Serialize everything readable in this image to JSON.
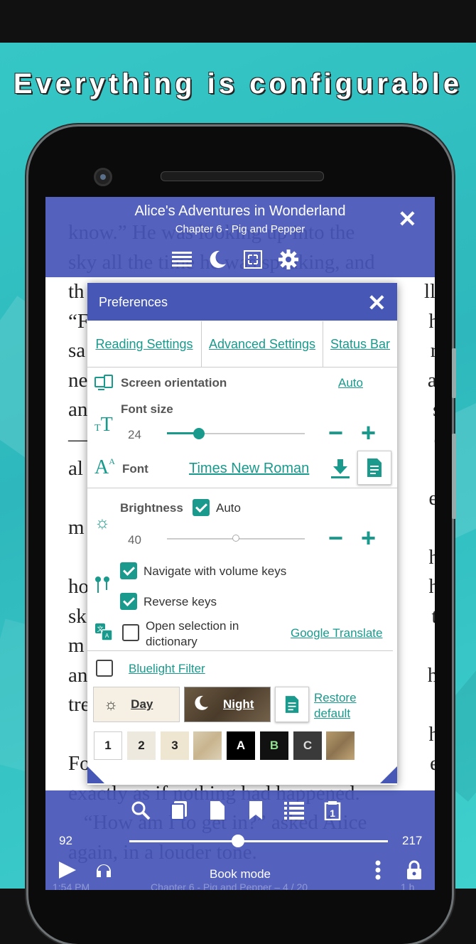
{
  "headline": "Everything is configurable",
  "book": {
    "title": "Alice's Adventures in Wonderland",
    "chapter": "Chapter 6 - Pig and Pepper",
    "lines": [
      "know.” He was looking up into the",
      "sky all the time he was speaking, and",
      "th                                                                  ll.",
      "“F                                                                  he",
      "sa                                                                   ry",
      "ne                                                                  at",
      "an                                                                   s.",
      "—                                                                   d,",
      "al",
      "                                                                      e-",
      "m",
      "                                                                      he",
      "ho                                                                  he",
      "sk                                                                   t-",
      "m                                                                    e,",
      "an                                                                  he",
      "tre",
      "                                                                      he",
      "Fo                                                                  e,",
      "exactly as if nothing had happened.",
      "   “How am I to get in?” asked Alice",
      "again, in a louder tone."
    ]
  },
  "bottom_bar": {
    "current_page": "92",
    "total_pages": "217",
    "mode": "Book mode",
    "footer_time": "1:54 PM",
    "footer_chapter": "Chapter 6 - Pig and Pepper – 4 / 20",
    "footer_right": "1 h",
    "progress": 0.42
  },
  "prefs": {
    "title": "Preferences",
    "tabs": [
      "Reading Settings",
      "Advanced Settings",
      "Status Bar"
    ],
    "orientation_label": "Screen orientation",
    "orientation_value": "Auto",
    "font_size_label": "Font size",
    "font_size_value": "24",
    "font_size_level": 0.23,
    "font_label": "Font",
    "font_value": "Times New Roman",
    "brightness_label": "Brightness",
    "brightness_auto": "Auto",
    "brightness_value": "40",
    "brightness_level": 0.5,
    "volume_keys": "Navigate with volume keys",
    "reverse_keys": "Reverse keys",
    "open_selection": "Open selection in dictionary",
    "open_selection_line1": "Open selection in",
    "open_selection_line2": "dictionary",
    "google_translate": "Google Translate",
    "bluelight": "Bluelight Filter",
    "day": "Day",
    "night": "Night",
    "restore_1": "Restore",
    "restore_2": "default",
    "swatches": [
      "1",
      "2",
      "3",
      "A",
      "B",
      "C"
    ]
  },
  "colors": {
    "background": "#35c7c5",
    "bar": "#4756b9",
    "accent": "#1a9a8c"
  }
}
